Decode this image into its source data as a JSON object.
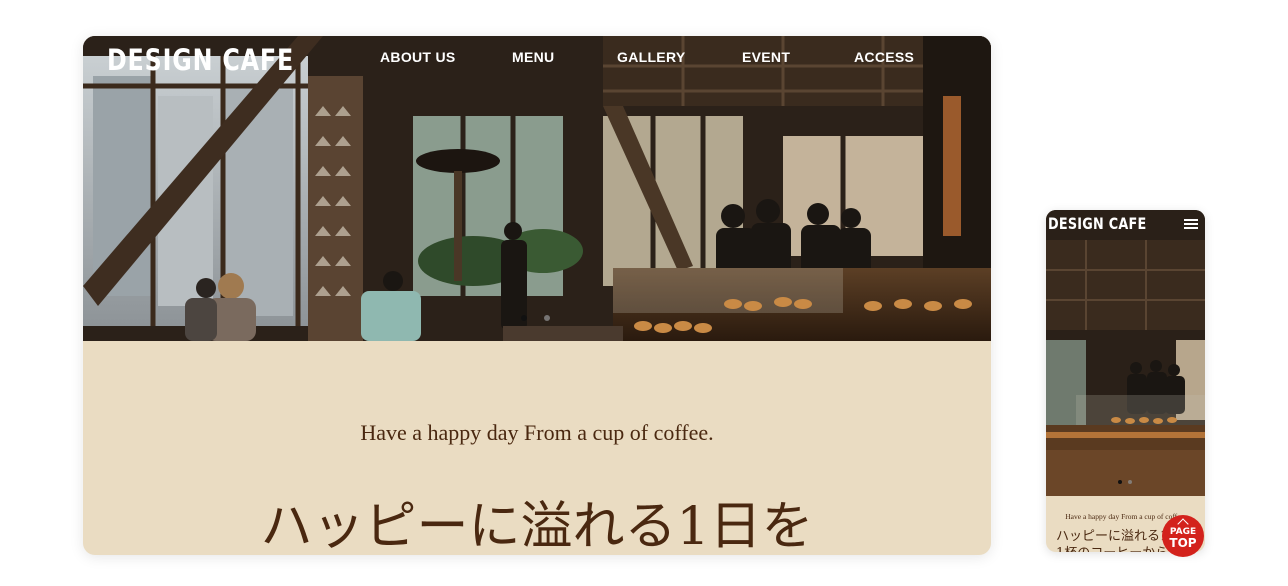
{
  "site": {
    "logo": "DESIGN CAFE",
    "nav": [
      "ABOUT US",
      "MENU",
      "GALLERY",
      "EVENT",
      "ACCESS"
    ],
    "tagline": "Have a happy day From a cup of coffee.",
    "headline": "ハッピーに溢れる1日を",
    "mobile_headline": "ハッピーに溢れる1日を1杯のコーヒーから"
  },
  "slider": {
    "slide_count": 2,
    "active_index": 0
  },
  "page_top": {
    "line1": "PAGE",
    "line2": "TOP"
  },
  "icons": {
    "menu": "hamburger-menu-icon",
    "page_top_arrow": "chevron-up-icon"
  },
  "colors": {
    "accent_red": "#d3221c",
    "cream_background": "#eadcc2",
    "brown_text": "#4a2810"
  }
}
